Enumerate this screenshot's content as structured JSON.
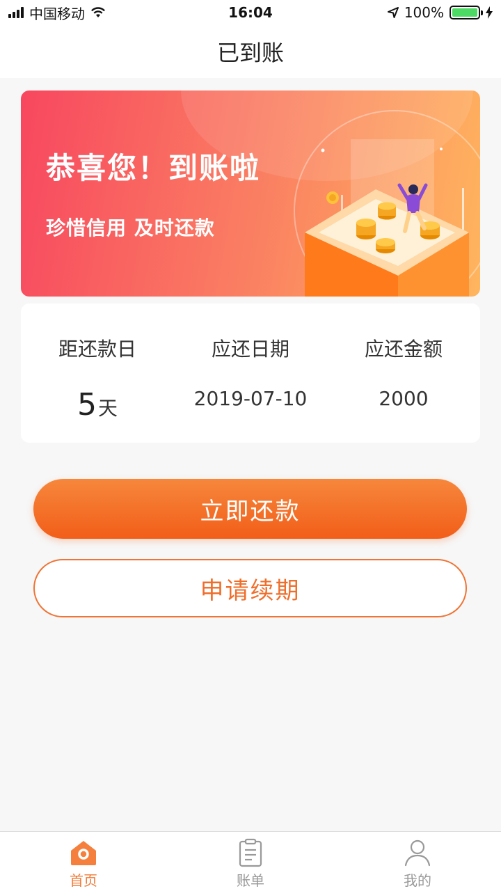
{
  "status_bar": {
    "carrier": "中国移动",
    "time": "16:04",
    "battery_text": "100%",
    "battery_level": 1.0
  },
  "nav": {
    "title": "已到账"
  },
  "banner": {
    "title": "恭喜您！到账啦",
    "subtitle": "珍惜信用  及时还款"
  },
  "info": {
    "days_label": "距还款日",
    "days_value": "5",
    "days_unit": "天",
    "date_label": "应还日期",
    "date_value": "2019-07-10",
    "amount_label": "应还金额",
    "amount_value": "2000"
  },
  "actions": {
    "repay_label": "立即还款",
    "renew_label": "申请续期"
  },
  "tabbar": {
    "items": [
      {
        "label": "首页",
        "icon": "home-icon",
        "active": true
      },
      {
        "label": "账单",
        "icon": "bill-icon",
        "active": false
      },
      {
        "label": "我的",
        "icon": "user-icon",
        "active": false
      }
    ]
  },
  "colors": {
    "accent": "#f25e19",
    "accent_text": "#ef6e2a",
    "banner_start": "#f8475f",
    "banner_end": "#ffb55e",
    "battery": "#4cd964"
  }
}
